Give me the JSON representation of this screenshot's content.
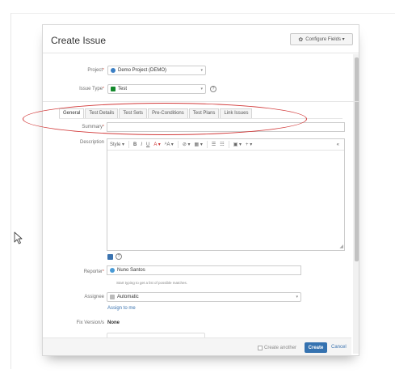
{
  "dialog": {
    "title": "Create Issue",
    "configure_label": "Configure Fields ▾"
  },
  "fields": {
    "project_label": "Project",
    "project_value": "Demo Project (DEMO)",
    "issue_type_label": "Issue Type",
    "issue_type_value": "Test",
    "summary_label": "Summary",
    "description_label": "Description",
    "reporter_label": "Reporter",
    "reporter_value": "Nuno Santos",
    "reporter_hint": "Start typing to get a list of possible matches.",
    "assignee_label": "Assignee",
    "assignee_value": "Automatic",
    "assign_to_me": "Assign to me",
    "fix_version_label": "Fix Version/s",
    "fix_version_value": "None"
  },
  "tabs": [
    {
      "label": "General"
    },
    {
      "label": "Test Details"
    },
    {
      "label": "Test Sets"
    },
    {
      "label": "Pre-Conditions"
    },
    {
      "label": "Test Plans"
    },
    {
      "label": "Link Issues"
    }
  ],
  "toolbar": {
    "style": "Style ▾",
    "bold": "B",
    "italic": "I",
    "underline": "U",
    "color": "A ▾",
    "size": "ᴬA ▾",
    "link": "⊘ ▾",
    "table": "▦ ▾",
    "bullets": "☰",
    "numbers": "☷",
    "image": "▣ ▾",
    "plus": "+ ▾",
    "collapse": "«"
  },
  "footer": {
    "create_another": "Create another",
    "create": "Create",
    "cancel": "Cancel"
  },
  "colors": {
    "accent": "#3572b0",
    "annotation": "#d23a3a",
    "required": "#d04437"
  }
}
